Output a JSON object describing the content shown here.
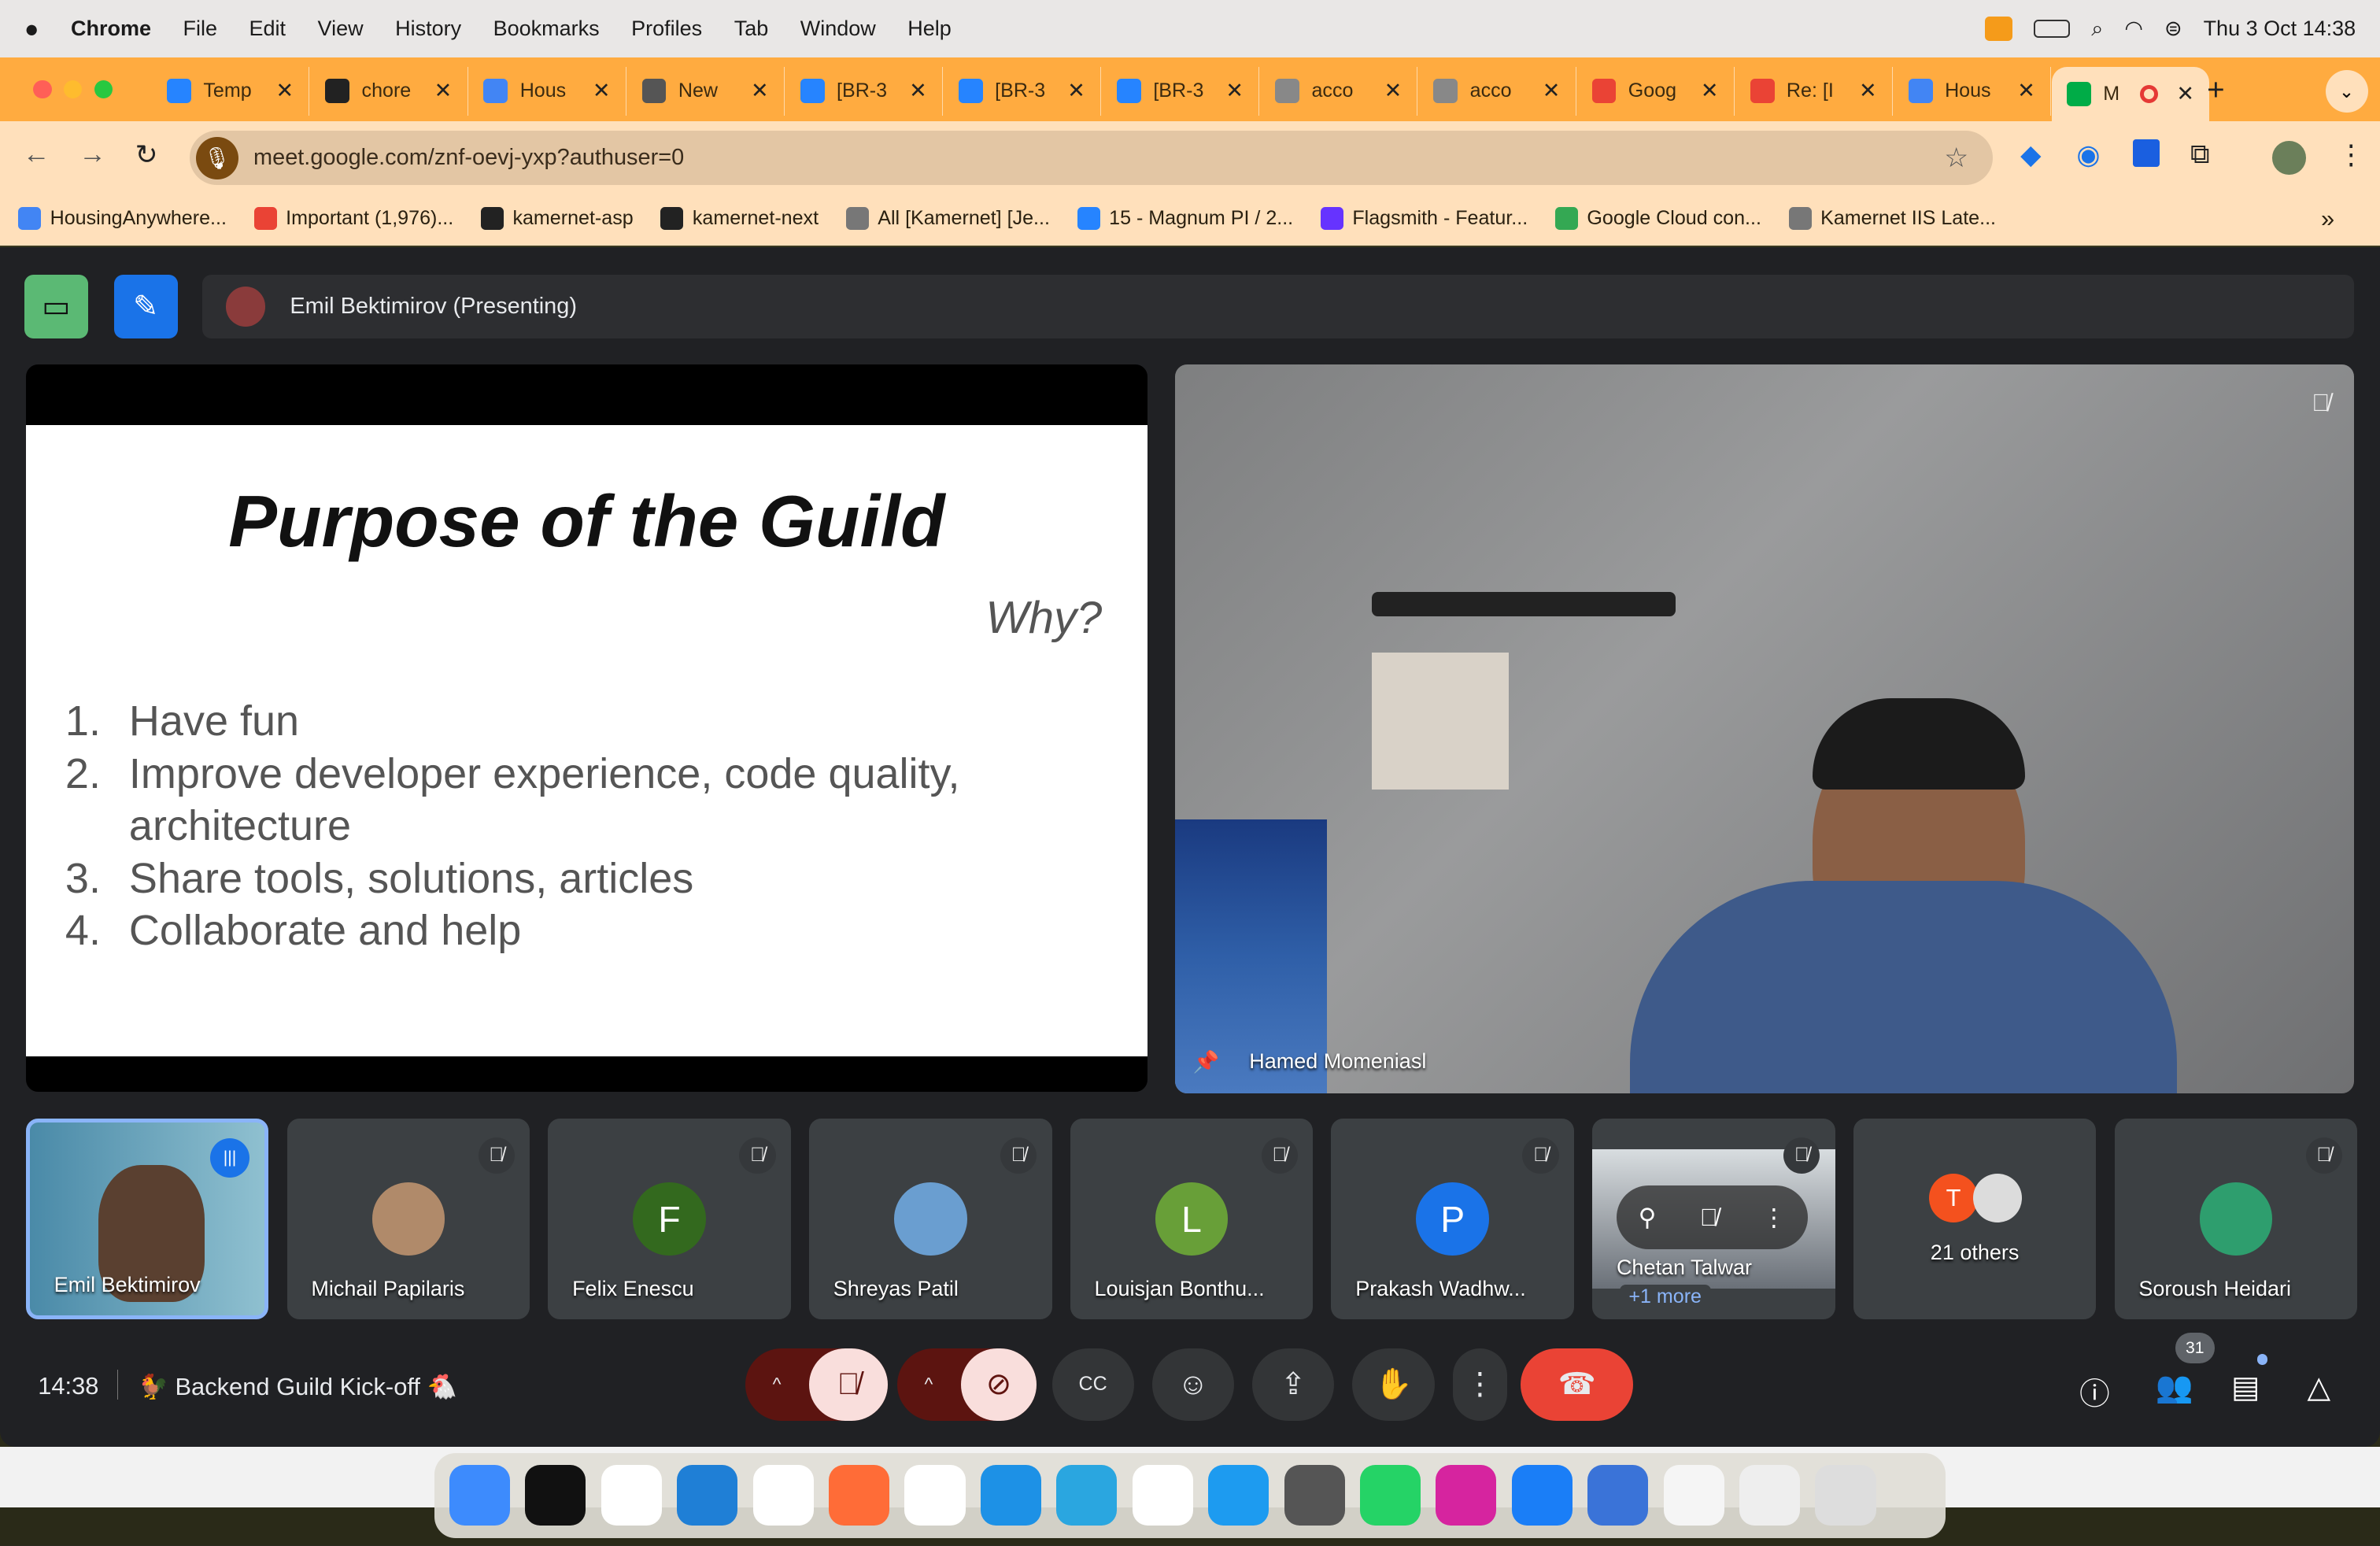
{
  "menubar": {
    "apple_icon": "apple-icon",
    "app": "Chrome",
    "items": [
      "File",
      "Edit",
      "View",
      "History",
      "Bookmarks",
      "Profiles",
      "Tab",
      "Window",
      "Help"
    ],
    "clock": "Thu 3 Oct  14:38"
  },
  "tabs": [
    {
      "title": "Temp",
      "icon": "jira-icon",
      "color": "#2684ff"
    },
    {
      "title": "chore",
      "icon": "github-icon",
      "color": "#222222"
    },
    {
      "title": "Hous",
      "icon": "calendar-icon",
      "color": "#4285f4"
    },
    {
      "title": "New",
      "icon": "chrome-icon",
      "color": "#555555"
    },
    {
      "title": "[BR-3",
      "icon": "jira-icon",
      "color": "#2684ff"
    },
    {
      "title": "[BR-3",
      "icon": "jira-icon",
      "color": "#2684ff"
    },
    {
      "title": "[BR-3",
      "icon": "jira-icon",
      "color": "#2684ff"
    },
    {
      "title": "acco",
      "icon": "globe-icon",
      "color": "#888888"
    },
    {
      "title": "acco",
      "icon": "globe-icon",
      "color": "#888888"
    },
    {
      "title": "Goog",
      "icon": "google-icon",
      "color": "#ea4335"
    },
    {
      "title": "Re: [I",
      "icon": "gmail-icon",
      "color": "#ea4335"
    },
    {
      "title": "Hous",
      "icon": "calendar-icon",
      "color": "#4285f4"
    },
    {
      "title": "M",
      "icon": "meet-icon",
      "color": "#00ac47",
      "active": true,
      "recording": true
    }
  ],
  "new_tab": "+",
  "address": {
    "url": "meet.google.com/znf-oevj-yxp?authuser=0"
  },
  "bookmarks": [
    {
      "label": "HousingAnywhere...",
      "color": "#4285f4"
    },
    {
      "label": "Important (1,976)...",
      "color": "#ea4335"
    },
    {
      "label": "kamernet-asp",
      "color": "#222222"
    },
    {
      "label": "kamernet-next",
      "color": "#222222"
    },
    {
      "label": "All [Kamernet] [Je...",
      "color": "#777777"
    },
    {
      "label": "15 - Magnum PI / 2...",
      "color": "#2684ff"
    },
    {
      "label": "Flagsmith - Featur...",
      "color": "#6633ff"
    },
    {
      "label": "Google Cloud con...",
      "color": "#34a853"
    },
    {
      "label": "Kamernet IIS Late...",
      "color": "#777777"
    }
  ],
  "bookmarks_more": "»",
  "meet": {
    "presenting": "Emil Bektimirov (Presenting)",
    "slide": {
      "title": "Purpose of the Guild",
      "subtitle": "Why?",
      "items": [
        {
          "n": "1.",
          "text": "Have fun"
        },
        {
          "n": "2.",
          "text": "Improve developer experience, code quality, architecture"
        },
        {
          "n": "3.",
          "text": "Share tools, solutions, articles"
        },
        {
          "n": "4.",
          "text": "Collaborate and help"
        }
      ]
    },
    "pinned_name": "Hamed Momeniasl",
    "tiles": [
      {
        "name": "Emil Bektimirov",
        "type": "video",
        "speaking": true
      },
      {
        "name": "Michail Papilaris",
        "type": "photo",
        "color": "#b08a6a"
      },
      {
        "name": "Felix Enescu",
        "type": "letter",
        "letter": "F",
        "color": "#33691e"
      },
      {
        "name": "Shreyas Patil",
        "type": "photo",
        "color": "#6a9ed0"
      },
      {
        "name": "Louisjan Bonthu...",
        "type": "letter",
        "letter": "L",
        "color": "#689f38"
      },
      {
        "name": "Prakash Wadhw...",
        "type": "letter",
        "letter": "P",
        "color": "#1a73e8"
      },
      {
        "name": "Chetan Talwar",
        "type": "video",
        "more": "+1 more"
      },
      {
        "name": "21 others",
        "type": "others",
        "letter": "T",
        "color": "#f4511e"
      },
      {
        "name": "Soroush Heidari",
        "type": "photo",
        "color": "#2e9e6e"
      }
    ],
    "time": "14:38",
    "meeting_title": "🐓 Backend Guild Kick-off 🐔",
    "participants_count": "31",
    "end_call_color": "#ea4335"
  }
}
